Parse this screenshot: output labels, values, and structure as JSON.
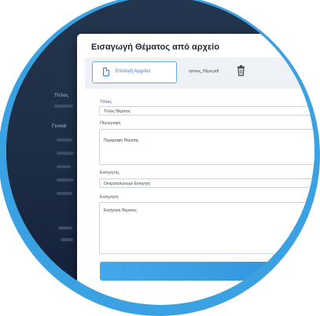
{
  "modal": {
    "title": "Εισαγωγή Θέματος από αρχείο",
    "file_button_label": "Επιλογή Αρχείου",
    "file_name": "ηποιος_Θέμα.pdf"
  },
  "fields": {
    "title_label": "Τίτλος",
    "title_value": "Τίτλος Θέματος",
    "description_label": "Περιγραφή",
    "description_value": "Περιγραφή Θέματος",
    "category_label": "Εισηγητής",
    "category_value": "Ονοματεπώνυμο Εισηγητή",
    "intro_label": "Εισήγηση",
    "intro_value": "Εισήγηση Θέματος"
  },
  "background": {
    "label_a": "Τίτλος",
    "label_b": "Γενικά"
  },
  "colors": {
    "accent": "#2f7bd8",
    "frame": "#3aa2e2"
  }
}
